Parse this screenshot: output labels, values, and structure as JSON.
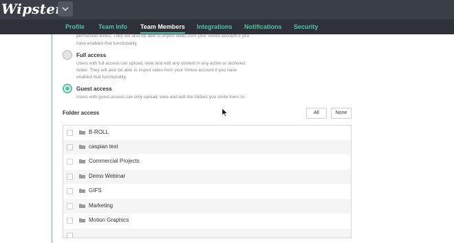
{
  "header": {
    "logo": "Wipster",
    "menu_icon": "chevron-down-icon"
  },
  "tabs": [
    {
      "label": "Profile",
      "active": false
    },
    {
      "label": "Team Info",
      "active": false
    },
    {
      "label": "Team Members",
      "active": true
    },
    {
      "label": "Integrations",
      "active": false
    },
    {
      "label": "Notifications",
      "active": false
    },
    {
      "label": "Security",
      "active": false
    }
  ],
  "permissions": {
    "truncated_desc_line1": "permission levels. They will also be able to import video from your Vimeo account if you",
    "truncated_desc_line2": "have enabled that functionality.",
    "options": [
      {
        "title": "Full access",
        "desc_line1": "Users with full access can upload, view and edit any content in any active or archived",
        "desc_line2": "folder. They will also be able to import video from your Vimeo account if you have",
        "desc_line3": "enabled that functionality.",
        "selected": false
      },
      {
        "title": "Guest access",
        "desc_line1": "Users with guest access can only upload, view and edit the folders you invite them to.",
        "selected": true
      }
    ]
  },
  "folder_access": {
    "title": "Folder access",
    "all_label": "All",
    "none_label": "None",
    "folders": [
      "B-ROLL",
      "caspian test",
      "Commercial Projects",
      "Demo Webinar",
      "GIFS",
      "Marketing",
      "Motion Graphics"
    ]
  },
  "colors": {
    "accent": "#4fc3a1",
    "topbar": "#3a3f47",
    "tabbar": "#2e3238"
  }
}
